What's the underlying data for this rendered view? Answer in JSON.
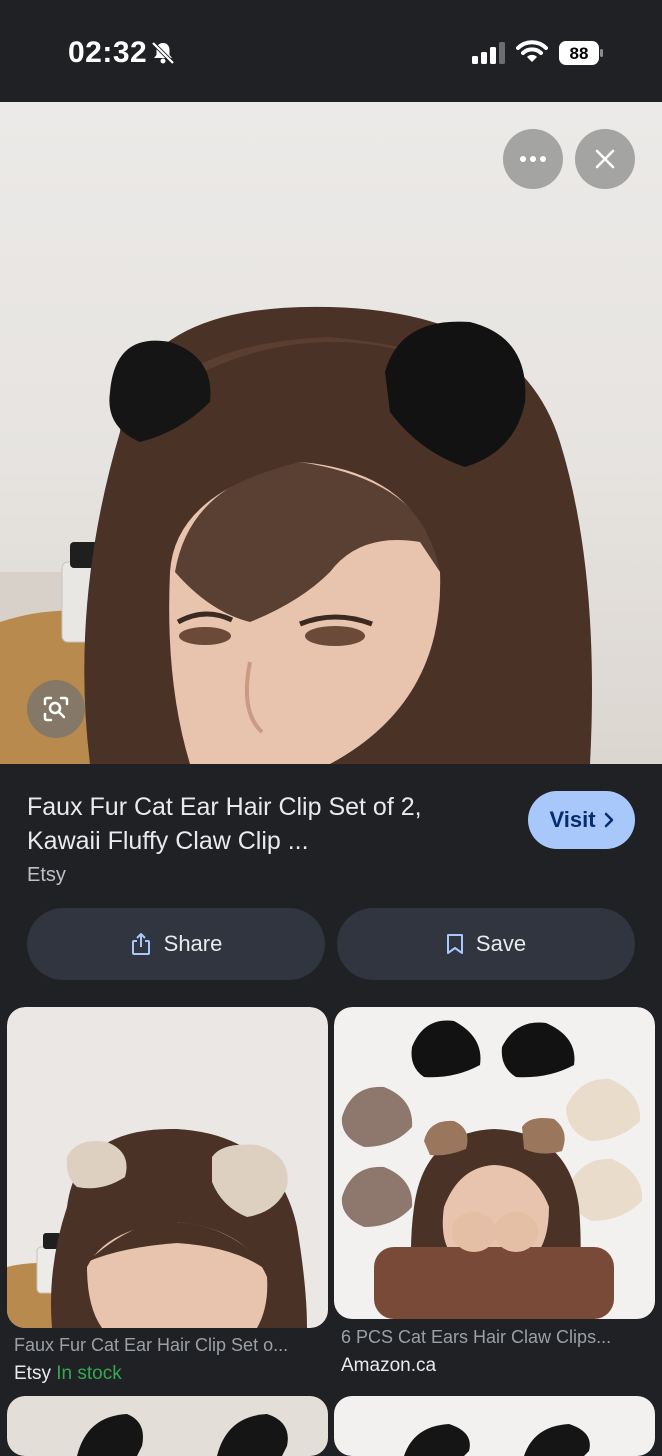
{
  "status_bar": {
    "time": "02:32",
    "battery": "88"
  },
  "result": {
    "title": "Faux Fur Cat Ear Hair Clip Set of 2, Kawaii Fluffy Claw Clip ...",
    "source": "Etsy",
    "visit_label": "Visit",
    "share_label": "Share",
    "save_label": "Save"
  },
  "related": [
    {
      "title": "Faux Fur Cat Ear Hair Clip Set o...",
      "source": "Etsy",
      "stock": "In stock"
    },
    {
      "title": "6 PCS Cat Ears Hair Claw Clips...",
      "source": "Amazon.ca"
    }
  ],
  "colors": {
    "background": "#202124",
    "visit_button": "#a8c7fa",
    "action_button": "#303540",
    "in_stock": "#34a853"
  },
  "icons": [
    "bell-off-icon",
    "signal-icon",
    "wifi-icon",
    "battery-icon",
    "more-icon",
    "close-icon",
    "lens-icon",
    "chevron-right-icon",
    "share-icon",
    "bookmark-icon"
  ]
}
